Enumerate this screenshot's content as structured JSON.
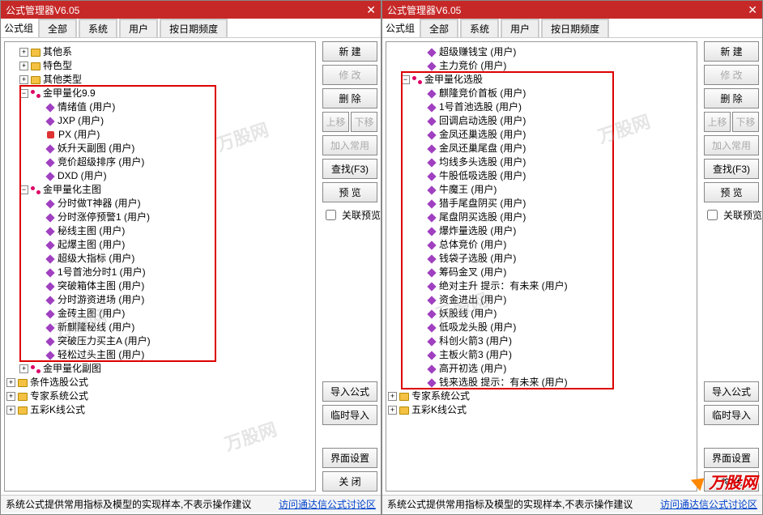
{
  "title": "公式管理器V6.05",
  "toolbar": {
    "group": "公式组",
    "tabs": [
      "全部",
      "系统",
      "用户",
      "按日期频度"
    ]
  },
  "buttons": {
    "new": "新  建",
    "edit": "修  改",
    "delete": "删  除",
    "up": "上移",
    "down": "下移",
    "addcommon": "加入常用",
    "find": "查找(F3)",
    "preview": "预  览",
    "linkpreview": "关联预览",
    "import": "导入公式",
    "tmpimport": "临时导入",
    "uisetting": "界面设置",
    "close": "关  闭"
  },
  "footer": {
    "note": "系统公式提供常用指标及模型的实现样本,不表示操作建议",
    "link": "访问通达信公式讨论区"
  },
  "suffix": {
    "user": "(用户)"
  },
  "leftTree": {
    "pre": [
      {
        "kind": "folder",
        "expand": "+",
        "depth": 1,
        "label": "其他系"
      },
      {
        "kind": "folder",
        "expand": "+",
        "depth": 1,
        "label": "特色型"
      },
      {
        "kind": "folder",
        "expand": "+",
        "depth": 1,
        "label": "其他类型"
      }
    ],
    "group1": {
      "label": "金甲量化9.9",
      "items": [
        "情绪值",
        "JXP",
        "PX",
        "妖升天副图",
        "竞价超级排序",
        "DXD"
      ]
    },
    "group2": {
      "label": "金甲量化主图",
      "items": [
        "分时做T神器",
        "分时涨停预警1",
        "秘线主图",
        "起爆主图",
        "超级大指标",
        "1号首池分时1",
        "突破箱体主图",
        "分时游资进场",
        "金砖主图",
        "新麒隆秘线",
        "突破压力买主A",
        "轻松过头主图"
      ]
    },
    "post": [
      {
        "kind": "folder",
        "expand": "+",
        "depth": 1,
        "icon": "bind",
        "label": "金甲量化副图"
      },
      {
        "kind": "folder",
        "expand": "+",
        "depth": 0,
        "icon": "folder",
        "label": "条件选股公式"
      },
      {
        "kind": "folder",
        "expand": "+",
        "depth": 0,
        "icon": "folder",
        "label": "专家系统公式"
      },
      {
        "kind": "folder",
        "expand": "+",
        "depth": 0,
        "icon": "folder",
        "label": "五彩K线公式"
      }
    ]
  },
  "rightTree": {
    "pre": [
      {
        "kind": "leaf",
        "depth": 2,
        "icon": "diamond",
        "label": "超级赚钱宝",
        "user": true
      },
      {
        "kind": "leaf",
        "depth": 2,
        "icon": "diamond",
        "label": "主力竞价",
        "user": true
      }
    ],
    "group": {
      "label": "金甲量化选股",
      "items": [
        "麒隆竞价首板",
        "1号首池选股",
        "回调启动选股",
        "金凤还巢选股",
        "金凤还巢尾盘",
        "均线多头选股",
        "牛股低吸选股",
        "牛魔王",
        "猎手尾盘阴买",
        "尾盘阴买选股",
        "爆炸量选股",
        "总体竞价",
        "钱袋子选股",
        "筹码金叉",
        "绝对主升  提示：有未来",
        "资金进出",
        "妖股线",
        "低吸龙头股",
        "科创火箭3",
        "主板火箭3",
        "高开初选",
        "钱来选股  提示：有未来"
      ]
    },
    "post": [
      {
        "kind": "folder",
        "expand": "+",
        "depth": 0,
        "icon": "folder",
        "label": "专家系统公式"
      },
      {
        "kind": "folder",
        "expand": "+",
        "depth": 0,
        "icon": "folder",
        "label": "五彩K线公式"
      }
    ]
  },
  "watermark": "万股网"
}
